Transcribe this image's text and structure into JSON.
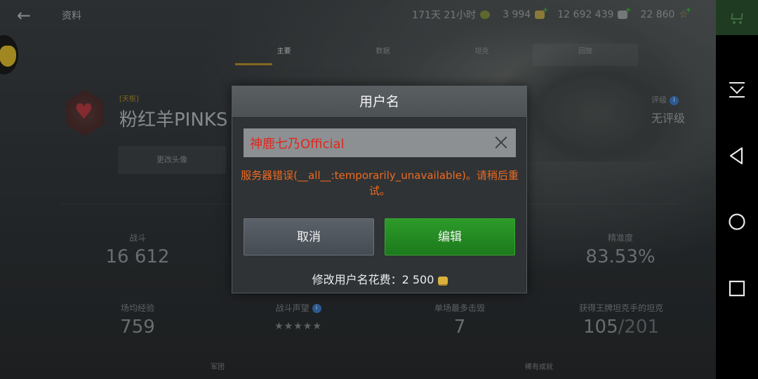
{
  "topbar": {
    "back_glyph": "←",
    "title": "资料",
    "time_played": "171天 21小时",
    "gold": "3 994",
    "credits": "12 692 439",
    "free_xp": "22 860"
  },
  "tabs": [
    {
      "label": "主要"
    },
    {
      "label": "数据"
    },
    {
      "label": "坦克"
    },
    {
      "label": "回放"
    }
  ],
  "profile": {
    "clan_tag": "[天枢]",
    "player_name": "粉红羊PINKS",
    "change_avatar": "更改头像",
    "rating_label": "评级",
    "rating_value": "无评级"
  },
  "stats": {
    "battles_label": "战斗",
    "battles_value": "16 612",
    "accuracy_label": "精准度",
    "accuracy_value": "83.53%",
    "avg_xp_label": "场均经验",
    "avg_xp_value": "759",
    "reputation_label": "战斗声望",
    "reputation_stars": "★★★★★",
    "max_kills_label": "单场最多击毁",
    "max_kills_value": "7",
    "mastery_label": "获得王牌坦克手的坦克",
    "mastery_count": "105",
    "mastery_total": "/201",
    "clan_section": "军团",
    "rare_section": "稀有成就"
  },
  "modal": {
    "title": "用户名",
    "input_value": "神鹿七乃Official",
    "error_message": "服务器错误(__all__:temporarily_unavailable)。请稍后重试。",
    "cancel_label": "取消",
    "edit_label": "编辑",
    "cost_label": "修改用户名花费：",
    "cost_value": "2 500"
  },
  "colors": {
    "error": "#f06a1e",
    "input_text": "#e0271c",
    "edit_button": "#2d9b2a"
  }
}
